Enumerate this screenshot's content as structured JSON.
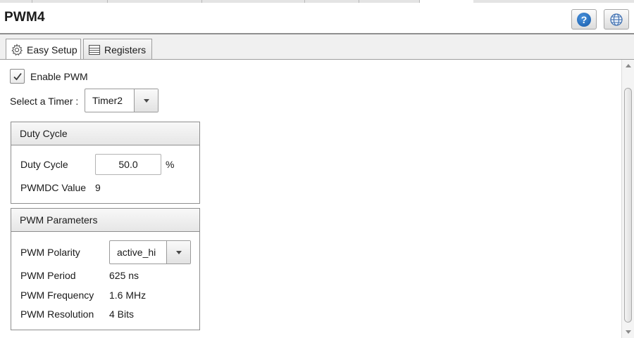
{
  "window": {
    "title": "PWM4",
    "help_icon": "help-icon",
    "globe_icon": "globe-icon",
    "help_glyph": "?"
  },
  "tabs": [
    {
      "label": "Easy Setup",
      "icon": "gear-icon",
      "active": true
    },
    {
      "label": "Registers",
      "icon": "registers-icon",
      "active": false
    }
  ],
  "form": {
    "enable_label": "Enable PWM",
    "enable_checked": true,
    "timer_label": "Select a Timer :",
    "timer_value": "Timer2",
    "duty_group": {
      "title": "Duty Cycle",
      "duty_label": "Duty Cycle",
      "duty_value": "50.0",
      "duty_unit": "%",
      "pwmdc_label": "PWMDC Value",
      "pwmdc_value": "9"
    },
    "params_group": {
      "title": "PWM Parameters",
      "polarity_label": "PWM Polarity",
      "polarity_value": "active_hi",
      "period_label": "PWM Period",
      "period_value": "625 ns",
      "frequency_label": "PWM Frequency",
      "frequency_value": "1.6 MHz",
      "resolution_label": "PWM Resolution",
      "resolution_value": "4 Bits"
    }
  },
  "colors": {
    "help_blue": "#1459a8",
    "border": "#8e8e8e"
  }
}
